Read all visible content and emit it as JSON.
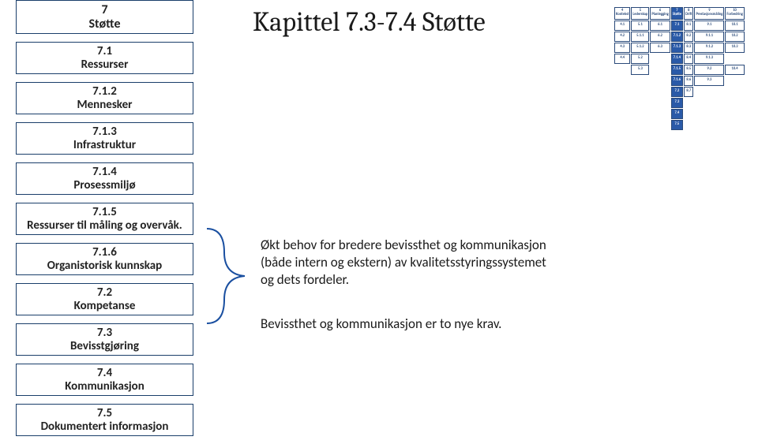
{
  "title": "Kapittel 7.3-7.4  Støtte",
  "left_boxes": [
    {
      "num": "7",
      "label": "Støtte",
      "big": true
    },
    {
      "num": "7.1",
      "label": "Ressurser"
    },
    {
      "num": "7.1.2",
      "label": "Mennesker"
    },
    {
      "num": "7.1.3",
      "label": "Infrastruktur"
    },
    {
      "num": "7.1.4",
      "label": "Prosessmiljø"
    },
    {
      "num": "7.1.5",
      "label": "Ressurser til måling og overvåk."
    },
    {
      "num": "7.1.6",
      "label": "Organistorisk kunnskap"
    },
    {
      "num": "7.2",
      "label": "Kompetanse"
    },
    {
      "num": "7.3",
      "label": "Bevisstgjøring"
    },
    {
      "num": "7.4",
      "label": "Kommunikasjon"
    },
    {
      "num": "7.5",
      "label": "Dokumentert informasjon"
    }
  ],
  "paragraph1": "Økt behov for bredere bevissthet og kommunikasjon (både intern og ekstern) av kvalitetsstyringssystemet og dets fordeler.",
  "paragraph2": "Bevissthet og kommunikasjon er to nye krav.",
  "mini_headers": [
    {
      "num": "4",
      "label": "Kontekst"
    },
    {
      "num": "5",
      "label": "Lederskap"
    },
    {
      "num": "6",
      "label": "Planlegging"
    },
    {
      "num": "7",
      "label": "Støtte"
    },
    {
      "num": "8",
      "label": "Drift"
    },
    {
      "num": "9",
      "label": "Prestasjonsmåling"
    },
    {
      "num": "10",
      "label": "Forbedring"
    }
  ],
  "mini_rows": [
    [
      "4.1",
      "5.1",
      "6.1",
      "7.1",
      "8.1",
      "9.1",
      "10.1"
    ],
    [
      "4.2",
      "5.1.1",
      "6.2",
      "7.1.2",
      "8.2",
      "9.1.1",
      "10.2"
    ],
    [
      "4.3",
      "5.1.2",
      "6.3",
      "7.1.3",
      "8.3",
      "9.1.2",
      "10.3"
    ],
    [
      "4.4",
      "5.2",
      "",
      "7.1.4",
      "8.4",
      "9.1.3",
      ""
    ],
    [
      "",
      "5.3",
      "",
      "7.1.5",
      "8.5",
      "9.2",
      "10.4"
    ],
    [
      "",
      "",
      "",
      "7.1.6",
      "8.6",
      "9.3",
      ""
    ],
    [
      "",
      "",
      "",
      "7.2",
      "8.7",
      "",
      ""
    ],
    [
      "",
      "",
      "",
      "7.3",
      "",
      "",
      ""
    ],
    [
      "",
      "",
      "",
      "7.4",
      "",
      "",
      ""
    ],
    [
      "",
      "",
      "",
      "7.5",
      "",
      "",
      ""
    ]
  ],
  "mini_active_col": 3
}
